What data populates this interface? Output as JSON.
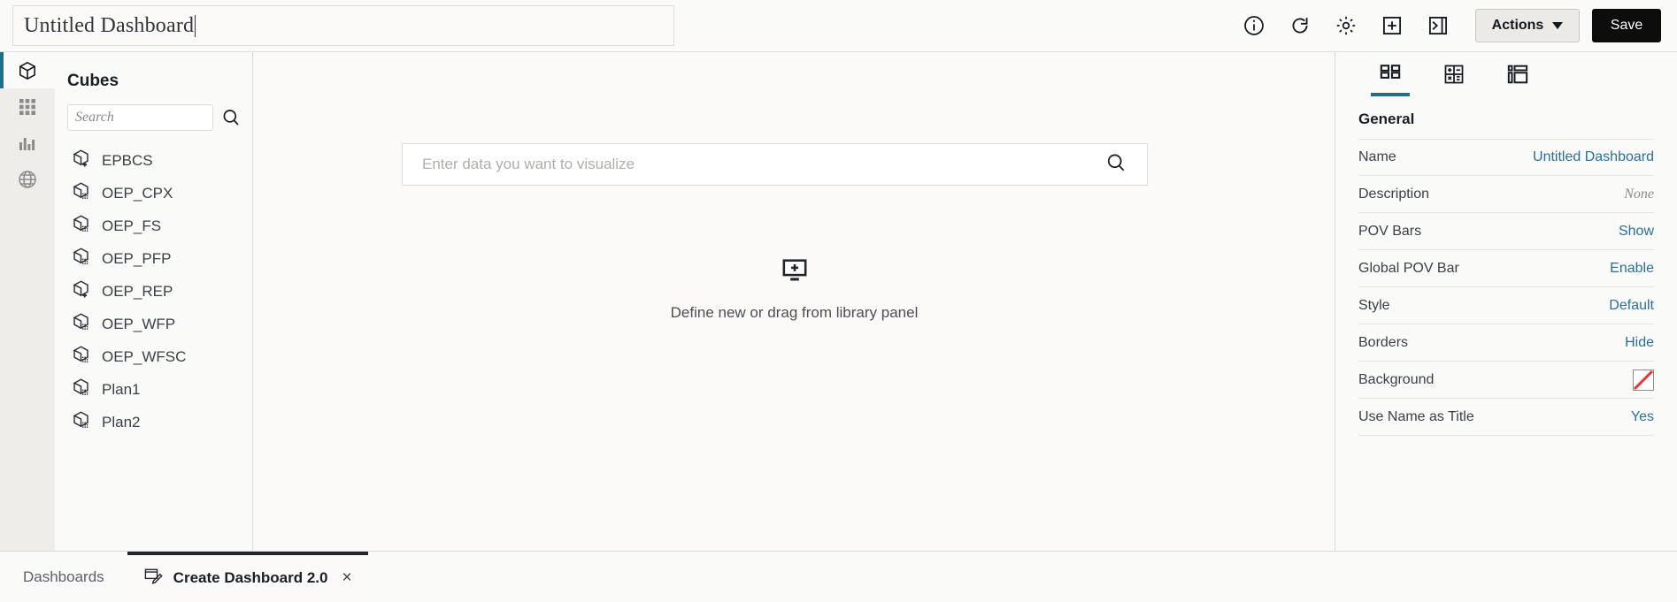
{
  "window": {
    "title_value": "Untitled Dashboard"
  },
  "toolbar": {
    "icons": [
      {
        "name": "info-icon",
        "label": "Info"
      },
      {
        "name": "refresh-icon",
        "label": "Refresh"
      },
      {
        "name": "gear-icon",
        "label": "Settings"
      },
      {
        "name": "add-box-icon",
        "label": "Add"
      },
      {
        "name": "collapse-panel-icon",
        "label": "Collapse Panel"
      }
    ],
    "actions_label": "Actions",
    "save_label": "Save"
  },
  "rail": {
    "items": [
      {
        "name": "sidebar-item-cubes",
        "icon": "cube-icon",
        "active": true
      },
      {
        "name": "sidebar-item-grid",
        "icon": "grid-icon",
        "active": false
      },
      {
        "name": "sidebar-item-charts",
        "icon": "bar-chart-icon",
        "active": false
      },
      {
        "name": "sidebar-item-globe",
        "icon": "globe-icon",
        "active": false
      }
    ]
  },
  "library": {
    "panel_title": "Cubes",
    "search_placeholder": "Search",
    "search_value": "",
    "search_icon": "search-icon",
    "cubes": [
      {
        "label": "EPBCS",
        "badge": "plus"
      },
      {
        "label": "OEP_CPX",
        "badge": "grid"
      },
      {
        "label": "OEP_FS",
        "badge": "grid"
      },
      {
        "label": "OEP_PFP",
        "badge": "grid"
      },
      {
        "label": "OEP_REP",
        "badge": "plus"
      },
      {
        "label": "OEP_WFP",
        "badge": "grid"
      },
      {
        "label": "OEP_WFSC",
        "badge": "grid"
      },
      {
        "label": "Plan1",
        "badge": "grid"
      },
      {
        "label": "Plan2",
        "badge": "grid"
      }
    ]
  },
  "canvas": {
    "viz_search_placeholder": "Enter data you want to visualize",
    "viz_search_value": "",
    "viz_search_icon": "search-icon",
    "dropzone_icon": "add-chart-icon",
    "dropzone_text": "Define new or drag from library panel"
  },
  "properties": {
    "tabs": [
      {
        "name": "tab-general",
        "icon": "properties-grid-icon",
        "active": true
      },
      {
        "name": "tab-calculation",
        "icon": "calculator-icon",
        "active": false
      },
      {
        "name": "tab-layout",
        "icon": "layout-icon",
        "active": false
      }
    ],
    "section_title": "General",
    "rows": [
      {
        "label": "Name",
        "value": "Untitled Dashboard",
        "kind": "link"
      },
      {
        "label": "Description",
        "value": "None",
        "kind": "none"
      },
      {
        "label": "POV Bars",
        "value": "Show",
        "kind": "link"
      },
      {
        "label": "Global POV Bar",
        "value": "Enable",
        "kind": "link"
      },
      {
        "label": "Style",
        "value": "Default",
        "kind": "link"
      },
      {
        "label": "Borders",
        "value": "Hide",
        "kind": "link"
      },
      {
        "label": "Background",
        "value": "",
        "kind": "swatch"
      },
      {
        "label": "Use Name as Title",
        "value": "Yes",
        "kind": "link"
      }
    ]
  },
  "bottom_tabs": {
    "dashboards_label": "Dashboards",
    "active_tab_label": "Create Dashboard 2.0",
    "active_tab_icon": "edit-dashboard-icon",
    "close_glyph": "×"
  },
  "colors": {
    "accent_teal": "#1f6f8b",
    "link_blue": "#2a6f9c",
    "swatch_red": "#e03a3a",
    "save_black": "#0d0d0d"
  }
}
